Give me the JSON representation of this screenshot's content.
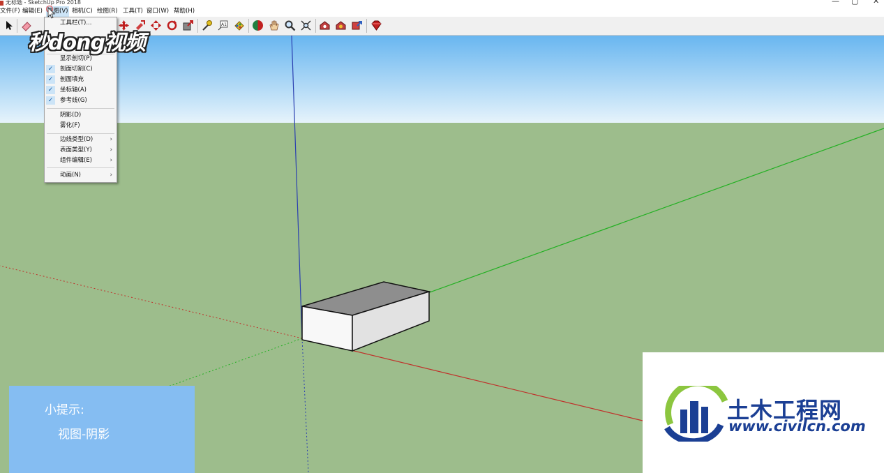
{
  "window": {
    "title": "无标题 - SketchUp Pro 2018",
    "minimize_glyph": "—",
    "maximize_glyph": "▢",
    "close_glyph": "✕"
  },
  "menubar": {
    "items": [
      {
        "label": "文件(F)"
      },
      {
        "label": "编辑(E)"
      },
      {
        "label": "视图(V)"
      },
      {
        "label": "相机(C)"
      },
      {
        "label": "绘图(R)"
      },
      {
        "label": "工具(T)"
      },
      {
        "label": "窗口(W)"
      },
      {
        "label": "帮助(H)"
      }
    ]
  },
  "view_menu": {
    "items": [
      {
        "label": "工具栏(T)..."
      },
      {
        "label": "显示剖切(P)"
      },
      {
        "label": "剖面切割(C)",
        "checked": true
      },
      {
        "label": "剖面填充",
        "checked": true
      },
      {
        "label": "坐标轴(A)",
        "checked": true
      },
      {
        "label": "参考线(G)",
        "checked": true
      },
      {
        "label": "阴影(D)"
      },
      {
        "label": "雾化(F)"
      },
      {
        "label": "边线类型(D)",
        "submenu": true
      },
      {
        "label": "表面类型(Y)",
        "submenu": true
      },
      {
        "label": "组件编辑(E)",
        "submenu": true
      },
      {
        "label": "动画(N)",
        "submenu": true
      }
    ],
    "check_glyph": "✓",
    "submenu_glyph": "›"
  },
  "watermark": {
    "text": "秒dong视频"
  },
  "tip": {
    "title": "小提示:",
    "body": "视图-阴影"
  },
  "logo": {
    "cn": "土木工程网",
    "url": "www.civilcn.com"
  },
  "colors": {
    "sky_top": "#68b6f0",
    "sky_bottom": "#e6f3fb",
    "ground": "#9dbd8c",
    "axis_blue": "#2a3fb0",
    "axis_green": "#22b022",
    "axis_red": "#c0302a",
    "tip_box": "#85bdf2",
    "logo_blue": "#1b3f94",
    "logo_green": "#8cc63f"
  }
}
